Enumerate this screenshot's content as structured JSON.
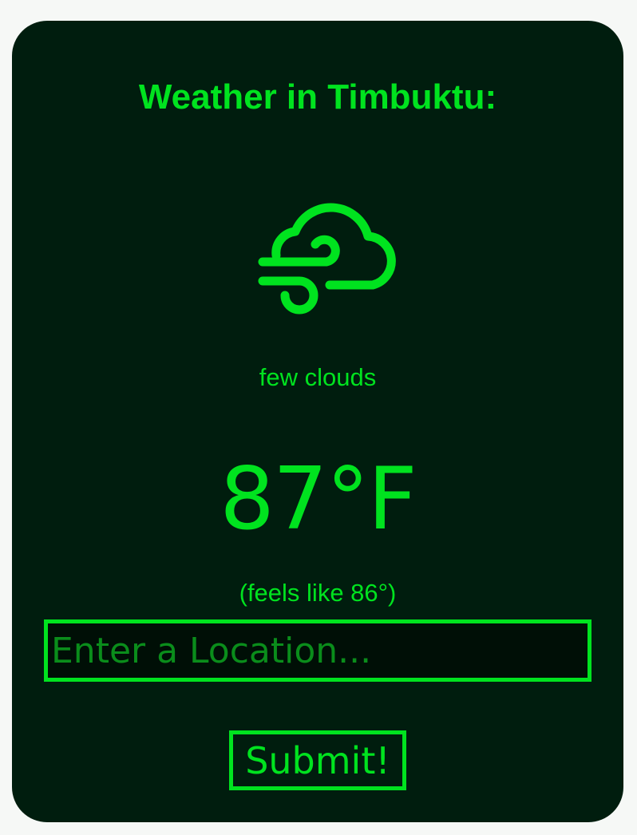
{
  "weather": {
    "title": "Weather in Timbuktu:",
    "icon": "wind-cloud-icon",
    "description": "few clouds",
    "temperature": "87°F",
    "feels_like": "(feels like 86°)"
  },
  "form": {
    "location_placeholder": "Enter a Location...",
    "location_value": "",
    "submit_label": "Submit!"
  },
  "colors": {
    "background": "#f6f8f6",
    "card": "#001d0e",
    "accent": "#00e31f",
    "placeholder": "#0a8d1b"
  }
}
